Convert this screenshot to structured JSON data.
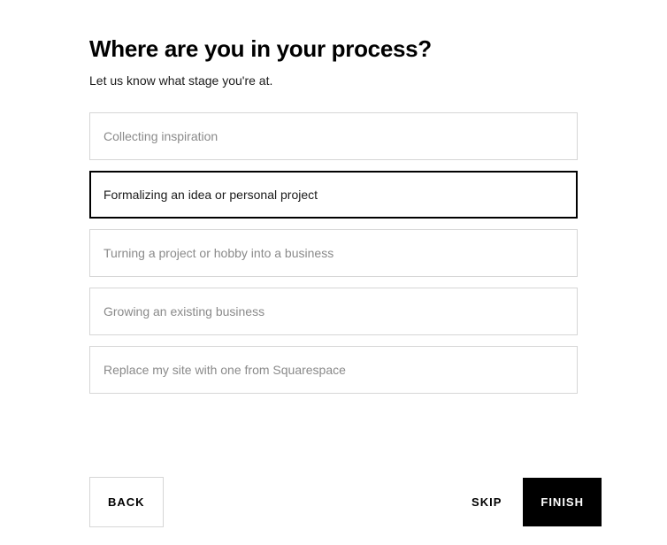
{
  "heading": "Where are you in your process?",
  "subheading": "Let us know what stage you're at.",
  "options": [
    {
      "label": "Collecting inspiration",
      "selected": false
    },
    {
      "label": "Formalizing an idea or personal project",
      "selected": true
    },
    {
      "label": "Turning a project or hobby into a business",
      "selected": false
    },
    {
      "label": "Growing an existing business",
      "selected": false
    },
    {
      "label": "Replace my site with one from Squarespace",
      "selected": false
    }
  ],
  "footer": {
    "back_label": "Back",
    "skip_label": "Skip",
    "finish_label": "Finish"
  }
}
